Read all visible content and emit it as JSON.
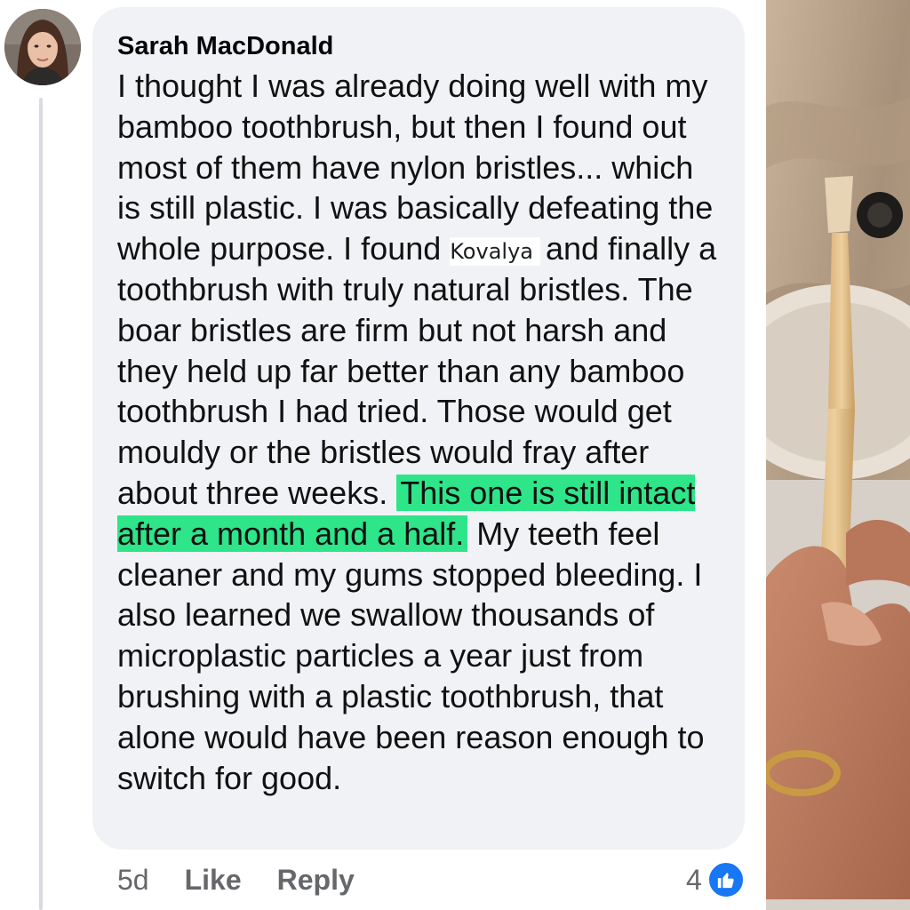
{
  "comment": {
    "author": "Sarah MacDonald",
    "text_part1": "I thought I was already doing well with my bamboo toothbrush, but then I found out most of them have nylon bristles... which is still plastic. I was basically defeating the whole purpose. I found ",
    "mention": "Kovalya",
    "text_part2": "and finally a toothbrush with truly natural bristles. The boar bristles are firm but not harsh and they held up far better than any bamboo toothbrush I had tried. Those would get mouldy or the bristles would fray after about three weeks. ",
    "highlighted_text": "This one is still intact after a month and a half.",
    "text_part3": " My teeth feel cleaner and my gums stopped bleeding. I also learned we swallow thousands of microplastic particles a year just from brushing with a plastic toothbrush, that alone would have been reason enough to switch for good."
  },
  "footer": {
    "timestamp": "5d",
    "like_label": "Like",
    "reply_label": "Reply",
    "reaction_count": "4"
  },
  "icons": {
    "reaction": "thumbs-up-icon",
    "avatar": "avatar",
    "photo": "toothbrush-photo"
  },
  "colors": {
    "bubble_bg": "#f0f2f5",
    "highlight": "#2ee58a",
    "like_blue": "#1877f2",
    "muted_text": "#65676b"
  }
}
